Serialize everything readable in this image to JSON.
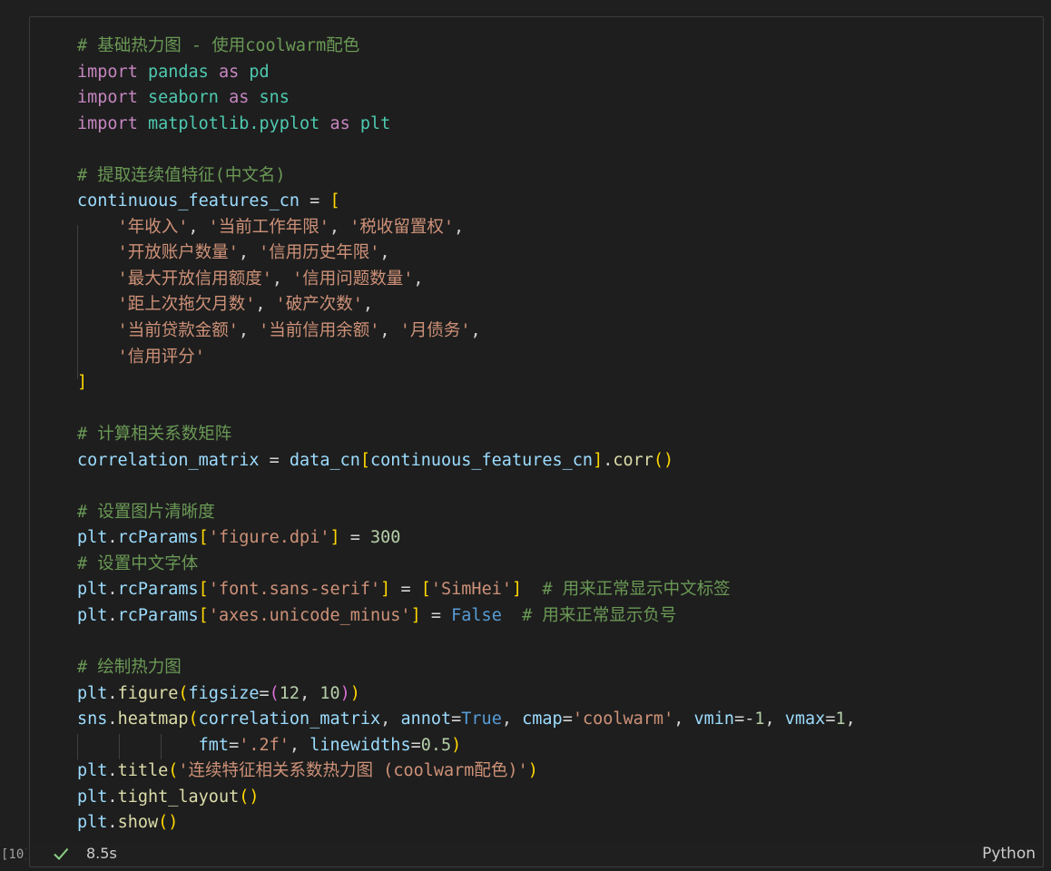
{
  "cell": {
    "execution_count": "[10]",
    "status_icon": "check-icon",
    "duration": "8.5s",
    "language": "Python",
    "colors": {
      "comment": "#6a9955",
      "keyword": "#c586c0",
      "string": "#ce9178",
      "variable": "#9cdcfe",
      "success": "#89d185"
    },
    "lines": [
      [
        {
          "t": "comment",
          "v": "# 基础热力图 - 使用coolwarm配色"
        }
      ],
      [
        {
          "t": "keyword",
          "v": "import"
        },
        {
          "t": "op",
          "v": " "
        },
        {
          "t": "module",
          "v": "pandas"
        },
        {
          "t": "op",
          "v": " "
        },
        {
          "t": "keyword",
          "v": "as"
        },
        {
          "t": "op",
          "v": " "
        },
        {
          "t": "module",
          "v": "pd"
        }
      ],
      [
        {
          "t": "keyword",
          "v": "import"
        },
        {
          "t": "op",
          "v": " "
        },
        {
          "t": "module",
          "v": "seaborn"
        },
        {
          "t": "op",
          "v": " "
        },
        {
          "t": "keyword",
          "v": "as"
        },
        {
          "t": "op",
          "v": " "
        },
        {
          "t": "module",
          "v": "sns"
        }
      ],
      [
        {
          "t": "keyword",
          "v": "import"
        },
        {
          "t": "op",
          "v": " "
        },
        {
          "t": "module",
          "v": "matplotlib.pyplot"
        },
        {
          "t": "op",
          "v": " "
        },
        {
          "t": "keyword",
          "v": "as"
        },
        {
          "t": "op",
          "v": " "
        },
        {
          "t": "module",
          "v": "plt"
        }
      ],
      [],
      [
        {
          "t": "comment",
          "v": "# 提取连续值特征(中文名)"
        }
      ],
      [
        {
          "t": "var",
          "v": "continuous_features_cn"
        },
        {
          "t": "op",
          "v": " = "
        },
        {
          "t": "br1",
          "v": "["
        }
      ],
      [
        {
          "t": "op",
          "v": "    "
        },
        {
          "t": "string",
          "v": "'年收入'"
        },
        {
          "t": "op",
          "v": ", "
        },
        {
          "t": "string",
          "v": "'当前工作年限'"
        },
        {
          "t": "op",
          "v": ", "
        },
        {
          "t": "string",
          "v": "'税收留置权'"
        },
        {
          "t": "op",
          "v": ","
        }
      ],
      [
        {
          "t": "op",
          "v": "    "
        },
        {
          "t": "string",
          "v": "'开放账户数量'"
        },
        {
          "t": "op",
          "v": ", "
        },
        {
          "t": "string",
          "v": "'信用历史年限'"
        },
        {
          "t": "op",
          "v": ","
        }
      ],
      [
        {
          "t": "op",
          "v": "    "
        },
        {
          "t": "string",
          "v": "'最大开放信用额度'"
        },
        {
          "t": "op",
          "v": ", "
        },
        {
          "t": "string",
          "v": "'信用问题数量'"
        },
        {
          "t": "op",
          "v": ","
        }
      ],
      [
        {
          "t": "op",
          "v": "    "
        },
        {
          "t": "string",
          "v": "'距上次拖欠月数'"
        },
        {
          "t": "op",
          "v": ", "
        },
        {
          "t": "string",
          "v": "'破产次数'"
        },
        {
          "t": "op",
          "v": ","
        }
      ],
      [
        {
          "t": "op",
          "v": "    "
        },
        {
          "t": "string",
          "v": "'当前贷款金额'"
        },
        {
          "t": "op",
          "v": ", "
        },
        {
          "t": "string",
          "v": "'当前信用余额'"
        },
        {
          "t": "op",
          "v": ", "
        },
        {
          "t": "string",
          "v": "'月债务'"
        },
        {
          "t": "op",
          "v": ","
        }
      ],
      [
        {
          "t": "op",
          "v": "    "
        },
        {
          "t": "string",
          "v": "'信用评分'"
        }
      ],
      [
        {
          "t": "br1",
          "v": "]"
        }
      ],
      [],
      [
        {
          "t": "comment",
          "v": "# 计算相关系数矩阵"
        }
      ],
      [
        {
          "t": "var",
          "v": "correlation_matrix"
        },
        {
          "t": "op",
          "v": " = "
        },
        {
          "t": "var",
          "v": "data_cn"
        },
        {
          "t": "br1",
          "v": "["
        },
        {
          "t": "var",
          "v": "continuous_features_cn"
        },
        {
          "t": "br1",
          "v": "]"
        },
        {
          "t": "op",
          "v": "."
        },
        {
          "t": "func",
          "v": "corr"
        },
        {
          "t": "br1",
          "v": "()"
        }
      ],
      [],
      [
        {
          "t": "comment",
          "v": "# 设置图片清晰度"
        }
      ],
      [
        {
          "t": "var",
          "v": "plt"
        },
        {
          "t": "op",
          "v": "."
        },
        {
          "t": "var",
          "v": "rcParams"
        },
        {
          "t": "br1",
          "v": "["
        },
        {
          "t": "string",
          "v": "'figure.dpi'"
        },
        {
          "t": "br1",
          "v": "]"
        },
        {
          "t": "op",
          "v": " = "
        },
        {
          "t": "number",
          "v": "300"
        }
      ],
      [
        {
          "t": "comment",
          "v": "# 设置中文字体"
        }
      ],
      [
        {
          "t": "var",
          "v": "plt"
        },
        {
          "t": "op",
          "v": "."
        },
        {
          "t": "var",
          "v": "rcParams"
        },
        {
          "t": "br1",
          "v": "["
        },
        {
          "t": "string",
          "v": "'font.sans-serif'"
        },
        {
          "t": "br1",
          "v": "]"
        },
        {
          "t": "op",
          "v": " = "
        },
        {
          "t": "br1",
          "v": "["
        },
        {
          "t": "string",
          "v": "'SimHei'"
        },
        {
          "t": "br1",
          "v": "]"
        },
        {
          "t": "op",
          "v": "  "
        },
        {
          "t": "comment",
          "v": "# 用来正常显示中文标签"
        }
      ],
      [
        {
          "t": "var",
          "v": "plt"
        },
        {
          "t": "op",
          "v": "."
        },
        {
          "t": "var",
          "v": "rcParams"
        },
        {
          "t": "br1",
          "v": "["
        },
        {
          "t": "string",
          "v": "'axes.unicode_minus'"
        },
        {
          "t": "br1",
          "v": "]"
        },
        {
          "t": "op",
          "v": " = "
        },
        {
          "t": "const",
          "v": "False"
        },
        {
          "t": "op",
          "v": "  "
        },
        {
          "t": "comment",
          "v": "# 用来正常显示负号"
        }
      ],
      [],
      [
        {
          "t": "comment",
          "v": "# 绘制热力图"
        }
      ],
      [
        {
          "t": "var",
          "v": "plt"
        },
        {
          "t": "op",
          "v": "."
        },
        {
          "t": "func",
          "v": "figure"
        },
        {
          "t": "br1",
          "v": "("
        },
        {
          "t": "var",
          "v": "figsize"
        },
        {
          "t": "op",
          "v": "="
        },
        {
          "t": "br2",
          "v": "("
        },
        {
          "t": "number",
          "v": "12"
        },
        {
          "t": "op",
          "v": ", "
        },
        {
          "t": "number",
          "v": "10"
        },
        {
          "t": "br2",
          "v": ")"
        },
        {
          "t": "br1",
          "v": ")"
        }
      ],
      [
        {
          "t": "var",
          "v": "sns"
        },
        {
          "t": "op",
          "v": "."
        },
        {
          "t": "func",
          "v": "heatmap"
        },
        {
          "t": "br1",
          "v": "("
        },
        {
          "t": "var",
          "v": "correlation_matrix"
        },
        {
          "t": "op",
          "v": ", "
        },
        {
          "t": "var",
          "v": "annot"
        },
        {
          "t": "op",
          "v": "="
        },
        {
          "t": "const",
          "v": "True"
        },
        {
          "t": "op",
          "v": ", "
        },
        {
          "t": "var",
          "v": "cmap"
        },
        {
          "t": "op",
          "v": "="
        },
        {
          "t": "string",
          "v": "'coolwarm'"
        },
        {
          "t": "op",
          "v": ", "
        },
        {
          "t": "var",
          "v": "vmin"
        },
        {
          "t": "op",
          "v": "=-"
        },
        {
          "t": "number",
          "v": "1"
        },
        {
          "t": "op",
          "v": ", "
        },
        {
          "t": "var",
          "v": "vmax"
        },
        {
          "t": "op",
          "v": "="
        },
        {
          "t": "number",
          "v": "1"
        },
        {
          "t": "op",
          "v": ","
        }
      ],
      [
        {
          "t": "op",
          "v": "            "
        },
        {
          "t": "var",
          "v": "fmt"
        },
        {
          "t": "op",
          "v": "="
        },
        {
          "t": "string",
          "v": "'.2f'"
        },
        {
          "t": "op",
          "v": ", "
        },
        {
          "t": "var",
          "v": "linewidths"
        },
        {
          "t": "op",
          "v": "="
        },
        {
          "t": "number",
          "v": "0.5"
        },
        {
          "t": "br1",
          "v": ")"
        }
      ],
      [
        {
          "t": "var",
          "v": "plt"
        },
        {
          "t": "op",
          "v": "."
        },
        {
          "t": "func",
          "v": "title"
        },
        {
          "t": "br1",
          "v": "("
        },
        {
          "t": "string",
          "v": "'连续特征相关系数热力图 (coolwarm配色)'"
        },
        {
          "t": "br1",
          "v": ")"
        }
      ],
      [
        {
          "t": "var",
          "v": "plt"
        },
        {
          "t": "op",
          "v": "."
        },
        {
          "t": "func",
          "v": "tight_layout"
        },
        {
          "t": "br1",
          "v": "()"
        }
      ],
      [
        {
          "t": "var",
          "v": "plt"
        },
        {
          "t": "op",
          "v": "."
        },
        {
          "t": "func",
          "v": "show"
        },
        {
          "t": "br1",
          "v": "()"
        }
      ]
    ]
  }
}
